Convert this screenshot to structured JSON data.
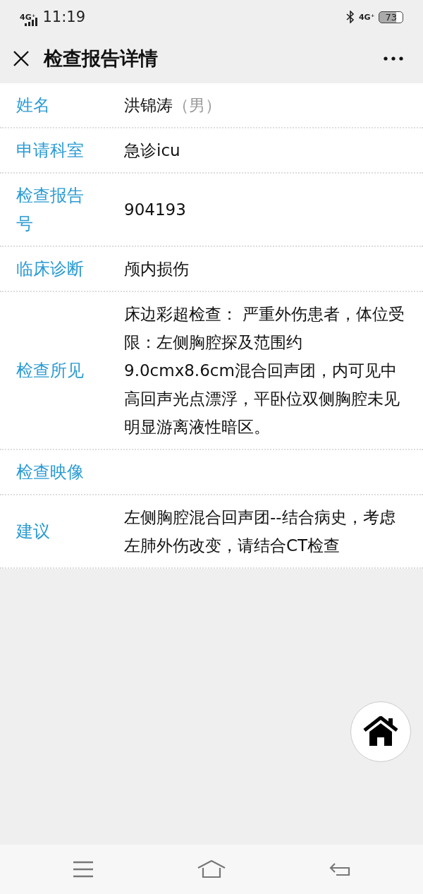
{
  "status_bar": {
    "network": "4G⁺",
    "time": "11:19",
    "network_right": "4G⁺",
    "battery": "73"
  },
  "header": {
    "title": "检查报告详情"
  },
  "rows": [
    {
      "label": "姓名",
      "value": "洪锦涛",
      "note": "（男）"
    },
    {
      "label": "申请科室",
      "value": "急诊icu"
    },
    {
      "label": "检查报告号",
      "value": "904193"
    },
    {
      "label": "临床诊断",
      "value": "颅内损伤"
    },
    {
      "label": "检查所见",
      "value": "床边彩超检查： 严重外伤患者，体位受限：左侧胸腔探及范围约9.0cmx8.6cm混合回声团，内可见中高回声光点漂浮，平卧位双侧胸腔未见明显游离液性暗区。"
    },
    {
      "label": "检查映像"
    },
    {
      "label": "建议",
      "value": "左侧胸腔混合回声团--结合病史，考虑左肺外伤改变，请结合CT检查"
    }
  ]
}
